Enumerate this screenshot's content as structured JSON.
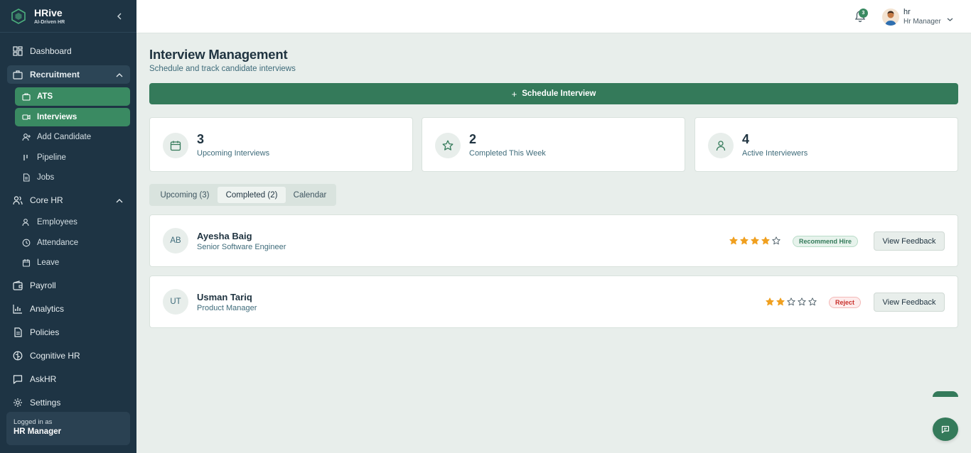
{
  "brand": {
    "name": "HRive",
    "tagline": "AI-Driven HR"
  },
  "sidebar": {
    "dashboard": "Dashboard",
    "recruitment": {
      "label": "Recruitment",
      "items": [
        {
          "label": "ATS",
          "icon": "briefcase-icon"
        },
        {
          "label": "Interviews",
          "icon": "video-icon"
        },
        {
          "label": "Add Candidate",
          "icon": "user-plus-icon"
        },
        {
          "label": "Pipeline",
          "icon": "pipeline-icon"
        },
        {
          "label": "Jobs",
          "icon": "file-icon"
        }
      ]
    },
    "core_hr": {
      "label": "Core HR",
      "items": [
        {
          "label": "Employees",
          "icon": "users-icon"
        },
        {
          "label": "Attendance",
          "icon": "clock-icon"
        },
        {
          "label": "Leave",
          "icon": "calendar-icon"
        }
      ]
    },
    "payroll": "Payroll",
    "analytics": "Analytics",
    "policies": "Policies",
    "cognitive_hr": "Cognitive HR",
    "askhr": "AskHR",
    "settings": "Settings",
    "login": {
      "label": "Logged in as",
      "role": "HR Manager"
    }
  },
  "topbar": {
    "notification_count": "3",
    "user_name": "hr",
    "user_role": "Hr Manager"
  },
  "main": {
    "title": "Interview Management",
    "subtitle": "Schedule and track candidate interviews",
    "schedule_button": "Schedule Interview",
    "stats": [
      {
        "value": "3",
        "label": "Upcoming Interviews",
        "icon": "calendar-icon"
      },
      {
        "value": "2",
        "label": "Completed This Week",
        "icon": "star-icon"
      },
      {
        "value": "4",
        "label": "Active Interviewers",
        "icon": "user-icon"
      }
    ],
    "tabs": [
      {
        "label": "Upcoming (3)",
        "active": false
      },
      {
        "label": "Completed (2)",
        "active": true
      },
      {
        "label": "Calendar",
        "active": false
      }
    ],
    "candidates": [
      {
        "initials": "AB",
        "name": "Ayesha Baig",
        "role": "Senior Software Engineer",
        "rating": 4,
        "rating_max": 5,
        "decision": "Recommend Hire",
        "action": "View Feedback"
      },
      {
        "initials": "UT",
        "name": "Usman Tariq",
        "role": "Product Manager",
        "rating": 2,
        "rating_max": 5,
        "decision": "Reject",
        "action": "View Feedback"
      }
    ]
  },
  "colors": {
    "sidebar_bg": "#1e3444",
    "accent": "#347a5a",
    "active_item": "#3a8a62",
    "star": "#f0a020",
    "reject": "#c9302c"
  }
}
